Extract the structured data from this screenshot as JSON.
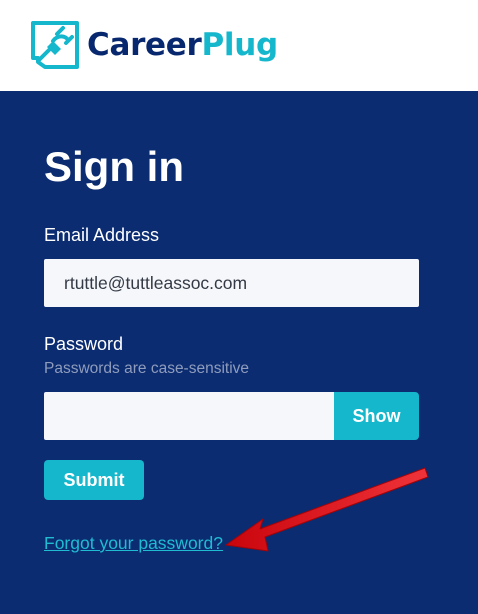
{
  "brand": {
    "name_part1": "Career",
    "name_part2": "Plug",
    "primary_color": "#07276e",
    "accent_color": "#14b7cc"
  },
  "signin": {
    "title": "Sign in",
    "email_label": "Email Address",
    "email_value": "rtuttle@tuttleassoc.com",
    "password_label": "Password",
    "password_hint": "Passwords are case-sensitive",
    "password_value": "",
    "show_label": "Show",
    "submit_label": "Submit",
    "forgot_label": "Forgot your password?"
  },
  "colors": {
    "panel_bg": "#0b2c71",
    "button_bg": "#14b7cc",
    "annotation_arrow": "#e0141b"
  },
  "annotation": {
    "icon": "red-arrow-pointer-icon"
  }
}
